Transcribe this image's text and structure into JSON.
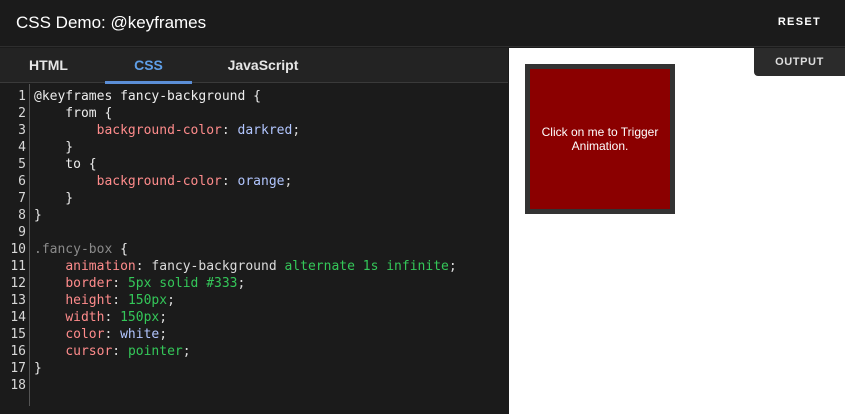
{
  "header": {
    "title": "CSS Demo: @keyframes",
    "reset_label": "RESET"
  },
  "tabs": [
    {
      "label": "HTML",
      "active": false
    },
    {
      "label": "CSS",
      "active": true
    },
    {
      "label": "JavaScript",
      "active": false
    }
  ],
  "code_lines": [
    {
      "n": "1",
      "tokens": [
        {
          "t": "@keyframes fancy-background {",
          "c": "kw"
        }
      ]
    },
    {
      "n": "2",
      "tokens": [
        {
          "t": "    from {",
          "c": "kw"
        }
      ]
    },
    {
      "n": "3",
      "tokens": [
        {
          "t": "        ",
          "c": "kw"
        },
        {
          "t": "background-color",
          "c": "prop"
        },
        {
          "t": ": ",
          "c": "val"
        },
        {
          "t": "darkred",
          "c": "kwblue"
        },
        {
          "t": ";",
          "c": "val"
        }
      ]
    },
    {
      "n": "4",
      "tokens": [
        {
          "t": "    }",
          "c": "kw"
        }
      ]
    },
    {
      "n": "5",
      "tokens": [
        {
          "t": "    to {",
          "c": "kw"
        }
      ]
    },
    {
      "n": "6",
      "tokens": [
        {
          "t": "        ",
          "c": "kw"
        },
        {
          "t": "background-color",
          "c": "prop"
        },
        {
          "t": ": ",
          "c": "val"
        },
        {
          "t": "orange",
          "c": "kwblue"
        },
        {
          "t": ";",
          "c": "val"
        }
      ]
    },
    {
      "n": "7",
      "tokens": [
        {
          "t": "    }",
          "c": "kw"
        }
      ]
    },
    {
      "n": "8",
      "tokens": [
        {
          "t": "}",
          "c": "kw"
        }
      ]
    },
    {
      "n": "9",
      "tokens": [
        {
          "t": "",
          "c": "kw"
        }
      ]
    },
    {
      "n": "10",
      "tokens": [
        {
          "t": ".fancy-box",
          "c": "sel"
        },
        {
          "t": " {",
          "c": "kw"
        }
      ]
    },
    {
      "n": "11",
      "tokens": [
        {
          "t": "    ",
          "c": "kw"
        },
        {
          "t": "animation",
          "c": "prop"
        },
        {
          "t": ": fancy-background ",
          "c": "val"
        },
        {
          "t": "alternate 1s infinite",
          "c": "green"
        },
        {
          "t": ";",
          "c": "val"
        }
      ]
    },
    {
      "n": "12",
      "tokens": [
        {
          "t": "    ",
          "c": "kw"
        },
        {
          "t": "border",
          "c": "prop"
        },
        {
          "t": ": ",
          "c": "val"
        },
        {
          "t": "5px solid #333",
          "c": "green"
        },
        {
          "t": ";",
          "c": "val"
        }
      ]
    },
    {
      "n": "13",
      "tokens": [
        {
          "t": "    ",
          "c": "kw"
        },
        {
          "t": "height",
          "c": "prop"
        },
        {
          "t": ": ",
          "c": "val"
        },
        {
          "t": "150px",
          "c": "green"
        },
        {
          "t": ";",
          "c": "val"
        }
      ]
    },
    {
      "n": "14",
      "tokens": [
        {
          "t": "    ",
          "c": "kw"
        },
        {
          "t": "width",
          "c": "prop"
        },
        {
          "t": ": ",
          "c": "val"
        },
        {
          "t": "150px",
          "c": "green"
        },
        {
          "t": ";",
          "c": "val"
        }
      ]
    },
    {
      "n": "15",
      "tokens": [
        {
          "t": "    ",
          "c": "kw"
        },
        {
          "t": "color",
          "c": "prop"
        },
        {
          "t": ": ",
          "c": "val"
        },
        {
          "t": "white",
          "c": "kwblue"
        },
        {
          "t": ";",
          "c": "val"
        }
      ]
    },
    {
      "n": "16",
      "tokens": [
        {
          "t": "    ",
          "c": "kw"
        },
        {
          "t": "cursor",
          "c": "prop"
        },
        {
          "t": ": ",
          "c": "val"
        },
        {
          "t": "pointer",
          "c": "green"
        },
        {
          "t": ";",
          "c": "val"
        }
      ]
    },
    {
      "n": "17",
      "tokens": [
        {
          "t": "}",
          "c": "kw"
        }
      ]
    },
    {
      "n": "18",
      "tokens": [
        {
          "t": "",
          "c": "kw"
        }
      ]
    }
  ],
  "output": {
    "tab_label": "OUTPUT",
    "box_text": "Click on me to Trigger Animation."
  },
  "colors": {
    "accent": "#5f9fe8",
    "box_background": "#8b0000",
    "box_border": "#333333"
  }
}
